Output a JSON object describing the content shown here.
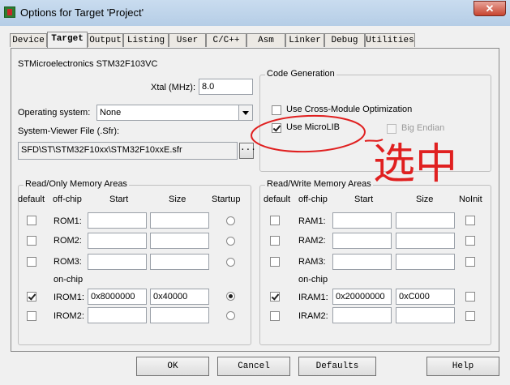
{
  "window": {
    "title": "Options for Target 'Project'",
    "close_label": "✕"
  },
  "tabs": [
    {
      "label": "Device",
      "active": false
    },
    {
      "label": "Target",
      "active": true
    },
    {
      "label": "Output",
      "active": false
    },
    {
      "label": "Listing",
      "active": false
    },
    {
      "label": "User",
      "active": false
    },
    {
      "label": "C/C++",
      "active": false
    },
    {
      "label": "Asm",
      "active": false
    },
    {
      "label": "Linker",
      "active": false
    },
    {
      "label": "Debug",
      "active": false
    },
    {
      "label": "Utilities",
      "active": false
    }
  ],
  "target": {
    "device_name": "STMicroelectronics STM32F103VC",
    "xtal_label": "Xtal (MHz):",
    "xtal_value": "8.0",
    "os_label": "Operating system:",
    "os_value": "None",
    "svf_label": "System-Viewer File (.Sfr):",
    "svf_value": "SFD\\ST\\STM32F10xx\\STM32F10xxE.sfr",
    "browse_label": "..."
  },
  "code_generation": {
    "title": "Code Generation",
    "cross_module": {
      "label": "Use Cross-Module Optimization",
      "checked": false
    },
    "microlib": {
      "label": "Use MicroLIB",
      "checked": true
    },
    "big_endian": {
      "label": "Big Endian",
      "checked": false,
      "disabled": true
    }
  },
  "rom_areas": {
    "title": "Read/Only Memory Areas",
    "headers": {
      "default": "default",
      "offchip": "off-chip",
      "start": "Start",
      "size": "Size",
      "startup": "Startup"
    },
    "onchip_label": "on-chip",
    "rows": [
      {
        "label": "ROM1:",
        "default": false,
        "start": "",
        "size": "",
        "startup": false
      },
      {
        "label": "ROM2:",
        "default": false,
        "start": "",
        "size": "",
        "startup": false
      },
      {
        "label": "ROM3:",
        "default": false,
        "start": "",
        "size": "",
        "startup": false
      },
      {
        "label": "IROM1:",
        "default": true,
        "start": "0x8000000",
        "size": "0x40000",
        "startup": true
      },
      {
        "label": "IROM2:",
        "default": false,
        "start": "",
        "size": "",
        "startup": false
      }
    ]
  },
  "ram_areas": {
    "title": "Read/Write Memory Areas",
    "headers": {
      "default": "default",
      "offchip": "off-chip",
      "start": "Start",
      "size": "Size",
      "noinit": "NoInit"
    },
    "onchip_label": "on-chip",
    "rows": [
      {
        "label": "RAM1:",
        "default": false,
        "start": "",
        "size": "",
        "noinit": false
      },
      {
        "label": "RAM2:",
        "default": false,
        "start": "",
        "size": "",
        "noinit": false
      },
      {
        "label": "RAM3:",
        "default": false,
        "start": "",
        "size": "",
        "noinit": false
      },
      {
        "label": "IRAM1:",
        "default": true,
        "start": "0x20000000",
        "size": "0xC000",
        "noinit": false
      },
      {
        "label": "IRAM2:",
        "default": false,
        "start": "",
        "size": "",
        "noinit": false
      }
    ]
  },
  "buttons": {
    "ok": "OK",
    "cancel": "Cancel",
    "defaults": "Defaults",
    "help": "Help"
  },
  "annotation": {
    "color": "#e02020",
    "text": "选中"
  }
}
